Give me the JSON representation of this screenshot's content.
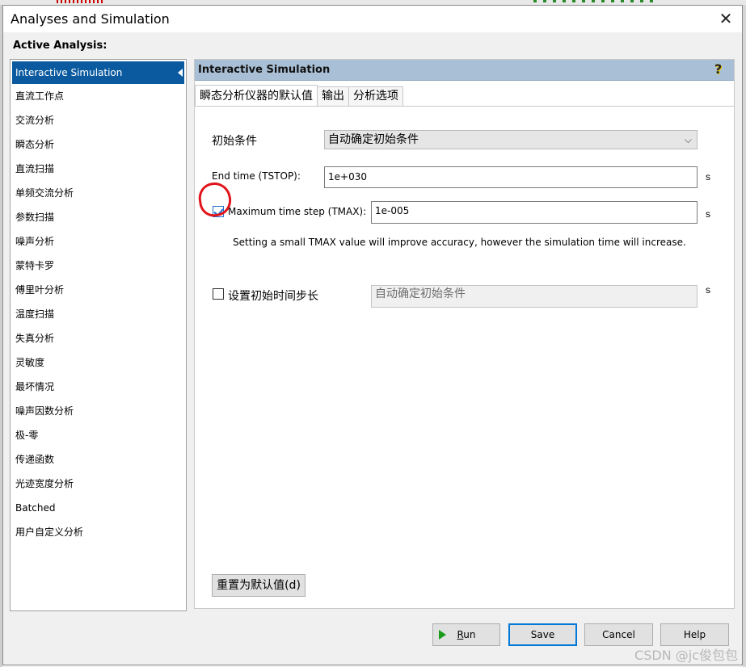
{
  "window": {
    "title": "Analyses and Simulation",
    "close_glyph": "✕"
  },
  "active_analysis_label": "Active Analysis:",
  "sidebar": {
    "items": [
      {
        "label": "Interactive Simulation",
        "selected": true
      },
      {
        "label": "直流工作点"
      },
      {
        "label": "交流分析"
      },
      {
        "label": "瞬态分析"
      },
      {
        "label": "直流扫描"
      },
      {
        "label": "单频交流分析"
      },
      {
        "label": "参数扫描"
      },
      {
        "label": "噪声分析"
      },
      {
        "label": "蒙特卡罗"
      },
      {
        "label": "傅里叶分析"
      },
      {
        "label": "温度扫描"
      },
      {
        "label": "失真分析"
      },
      {
        "label": "灵敏度"
      },
      {
        "label": "最坏情况"
      },
      {
        "label": "噪声因数分析"
      },
      {
        "label": "极-零"
      },
      {
        "label": "传递函数"
      },
      {
        "label": "光迹宽度分析"
      },
      {
        "label": "Batched"
      },
      {
        "label": "用户自定义分析"
      }
    ]
  },
  "panel": {
    "title": "Interactive Simulation",
    "help_glyph": "?",
    "tabs": [
      {
        "label": "瞬态分析仪器的默认值",
        "active": true
      },
      {
        "label": "输出"
      },
      {
        "label": "分析选项"
      }
    ],
    "initial_conditions": {
      "label": "初始条件",
      "value": "自动确定初始条件",
      "chevron": "⌵"
    },
    "end_time": {
      "label": "End time (TSTOP):",
      "value": "1e+030",
      "unit": "s"
    },
    "max_time_step": {
      "label": "Maximum time step (TMAX):",
      "value": "1e-005",
      "unit": "s",
      "checked": true
    },
    "hint": "Setting a small TMAX value will improve accuracy, however the simulation time will increase.",
    "initial_step": {
      "label": "设置初始时间步长",
      "value": "自动确定初始条件",
      "unit": "s",
      "checked": false
    },
    "reset_button": "重置为默认值(d)"
  },
  "footer": {
    "run_label_underlined": "R",
    "run_label_rest": "un",
    "save_label": "Save",
    "cancel_label": "Cancel",
    "help_label": "Help"
  },
  "watermark": "CSDN @jc俊包包",
  "colors": {
    "accent": "#0b5aa0",
    "header": "#a9bfd6",
    "annotation": "#e0141a",
    "run_icon": "#1a9c1a"
  }
}
